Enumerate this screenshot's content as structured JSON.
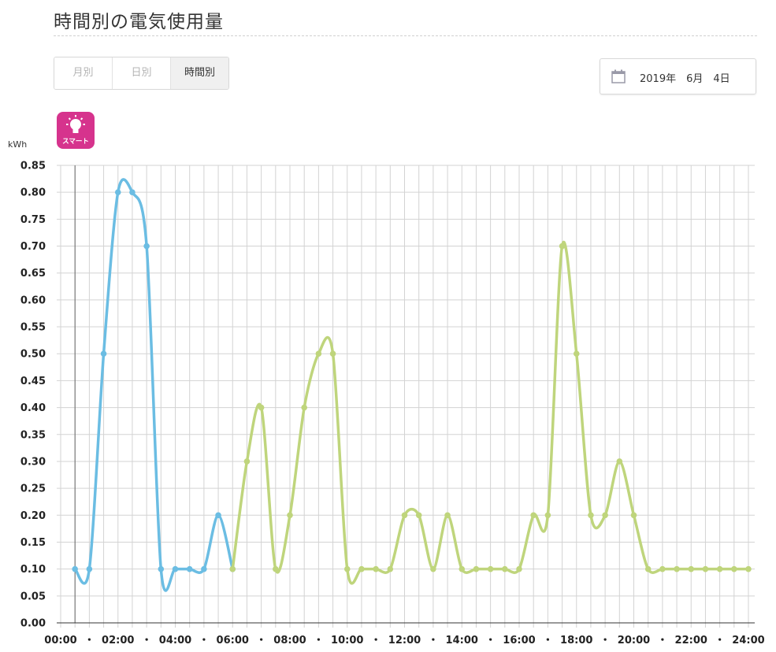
{
  "page": {
    "title": "時間別の電気使用量"
  },
  "tabs": [
    {
      "label": "月別",
      "active": false
    },
    {
      "label": "日別",
      "active": false
    },
    {
      "label": "時間別",
      "active": true
    }
  ],
  "date_picker": {
    "value": "2019年　6月　4日",
    "icon": "calendar-icon"
  },
  "badge": {
    "label": "スマート",
    "icon": "lightbulb-icon",
    "color": "#d6338d"
  },
  "colors": {
    "series_night": "#6bbde3",
    "series_day": "#bfd57c",
    "grid": "#d3d3d3"
  },
  "chart_data": {
    "type": "line",
    "ylabel": "kWh",
    "xlabel": "",
    "ylim": [
      0,
      0.85
    ],
    "yticks": [
      "0.00",
      "0.05",
      "0.10",
      "0.15",
      "0.20",
      "0.25",
      "0.30",
      "0.35",
      "0.40",
      "0.45",
      "0.50",
      "0.55",
      "0.60",
      "0.65",
      "0.70",
      "0.75",
      "0.80",
      "0.85"
    ],
    "xticks": [
      "00:00",
      "・",
      "02:00",
      "・",
      "04:00",
      "・",
      "06:00",
      "・",
      "08:00",
      "・",
      "10:00",
      "・",
      "12:00",
      "・",
      "14:00",
      "・",
      "16:00",
      "・",
      "18:00",
      "・",
      "20:00",
      "・",
      "22:00",
      "・",
      "24:00"
    ],
    "grid": true,
    "x": [
      "00:30",
      "01:00",
      "01:30",
      "02:00",
      "02:30",
      "03:00",
      "03:30",
      "04:00",
      "04:30",
      "05:00",
      "05:30",
      "06:00",
      "06:30",
      "07:00",
      "07:30",
      "08:00",
      "08:30",
      "09:00",
      "09:30",
      "10:00",
      "10:30",
      "11:00",
      "11:30",
      "12:00",
      "12:30",
      "13:00",
      "13:30",
      "14:00",
      "14:30",
      "15:00",
      "15:30",
      "16:00",
      "16:30",
      "17:00",
      "17:30",
      "18:00",
      "18:30",
      "19:00",
      "19:30",
      "20:00",
      "20:30",
      "21:00",
      "21:30",
      "22:00",
      "22:30",
      "23:00",
      "23:30",
      "24:00"
    ],
    "values": [
      0.1,
      0.1,
      0.5,
      0.8,
      0.8,
      0.7,
      0.1,
      0.1,
      0.1,
      0.1,
      0.2,
      0.1,
      0.3,
      0.4,
      0.1,
      0.2,
      0.4,
      0.5,
      0.5,
      0.1,
      0.1,
      0.1,
      0.1,
      0.2,
      0.2,
      0.1,
      0.2,
      0.1,
      0.1,
      0.1,
      0.1,
      0.1,
      0.2,
      0.2,
      0.7,
      0.5,
      0.2,
      0.2,
      0.3,
      0.2,
      0.1,
      0.1,
      0.1,
      0.1,
      0.1,
      0.1,
      0.1,
      0.1
    ],
    "series": [
      {
        "time_range": [
          "00:30",
          "06:00"
        ],
        "color": "#6bbde3"
      },
      {
        "time_range": [
          "06:00",
          "24:00"
        ],
        "color": "#bfd57c"
      }
    ]
  }
}
